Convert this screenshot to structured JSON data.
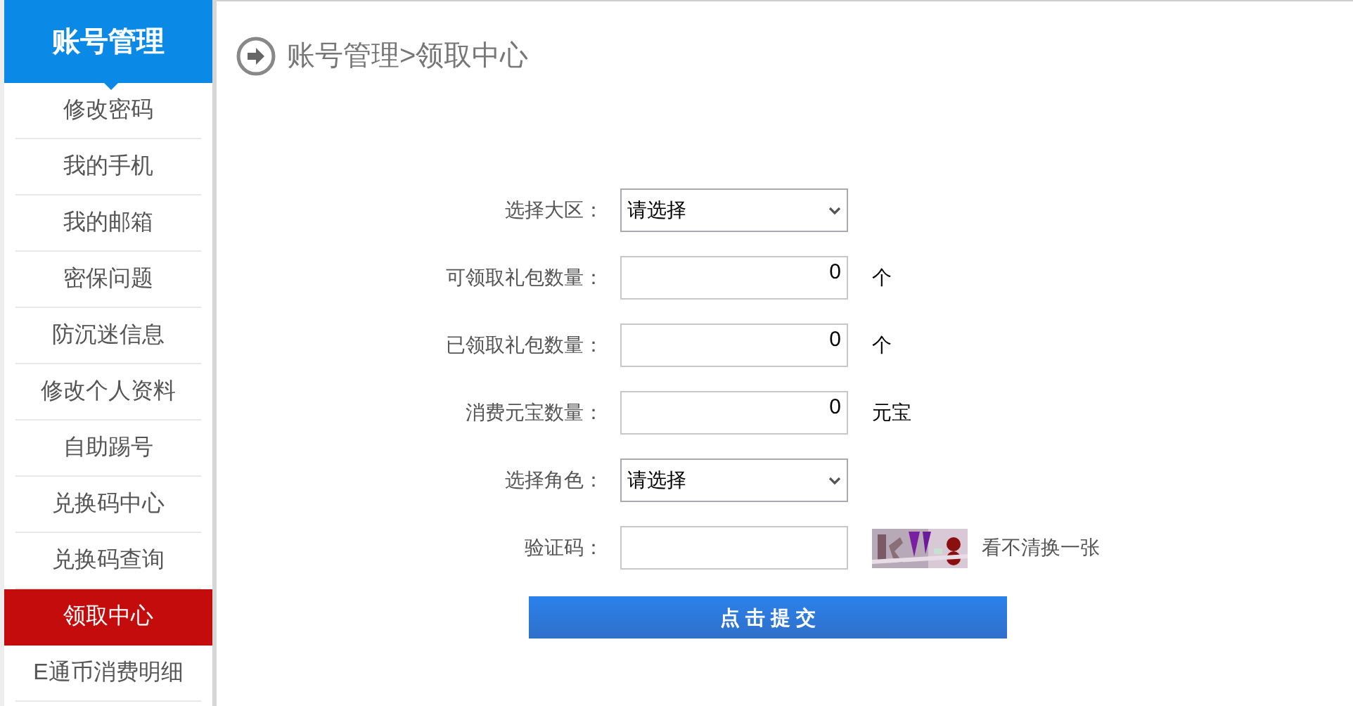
{
  "sidebar": {
    "title": "账号管理",
    "items": [
      {
        "label": "修改密码",
        "selected": false
      },
      {
        "label": "我的手机",
        "selected": false
      },
      {
        "label": "我的邮箱",
        "selected": false
      },
      {
        "label": "密保问题",
        "selected": false
      },
      {
        "label": "防沉迷信息",
        "selected": false
      },
      {
        "label": "修改个人资料",
        "selected": false
      },
      {
        "label": "自助踢号",
        "selected": false
      },
      {
        "label": "兑换码中心",
        "selected": false
      },
      {
        "label": "兑换码查询",
        "selected": false
      },
      {
        "label": "领取中心",
        "selected": true
      },
      {
        "label": "E通币消费明细",
        "selected": false
      }
    ]
  },
  "breadcrumb": "账号管理>领取中心",
  "form": {
    "fields": [
      {
        "kind": "select",
        "label": "选择大区：",
        "value": "请选择"
      },
      {
        "kind": "number",
        "label": "可领取礼包数量：",
        "value": "0",
        "unit": "个"
      },
      {
        "kind": "number",
        "label": "已领取礼包数量：",
        "value": "0",
        "unit": "个"
      },
      {
        "kind": "number",
        "label": "消费元宝数量：",
        "value": "0",
        "unit": "元宝"
      },
      {
        "kind": "select",
        "label": "选择角色：",
        "value": "请选择"
      },
      {
        "kind": "captcha",
        "label": "验证码：",
        "refresh_link": "看不清换一张"
      }
    ],
    "submit": "点 击 提 交"
  }
}
